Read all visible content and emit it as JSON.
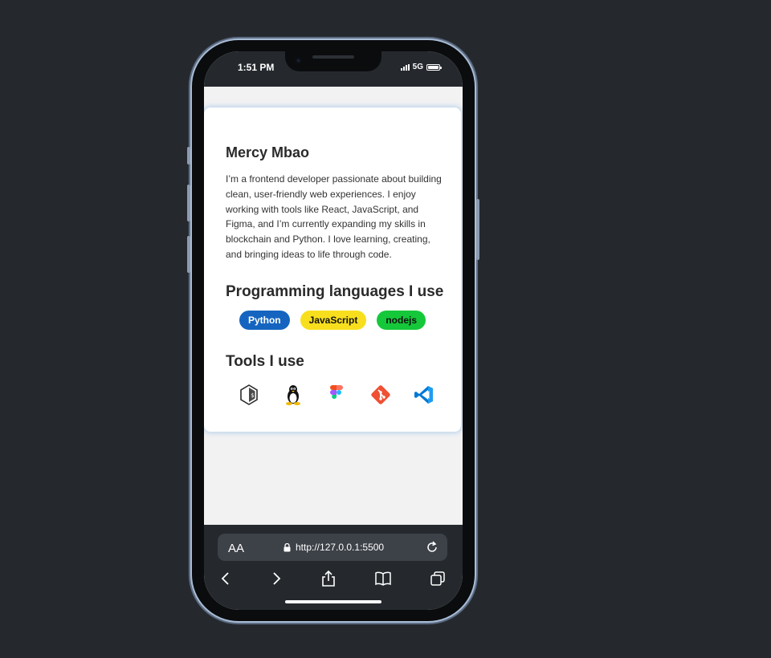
{
  "status": {
    "time": "1:51 PM",
    "network": "5G"
  },
  "profile": {
    "name": "Mercy Mbao",
    "bio": "I’m a frontend developer passionate about building clean, user-friendly web experiences. I enjoy working with tools like React, JavaScript, and Figma, and I’m currently expanding my skills in blockchain and Python. I love learning, creating, and bringing ideas to life through code."
  },
  "languages": {
    "heading": "Programming languages I use",
    "items": [
      {
        "label": "Python",
        "color": "#1565c0"
      },
      {
        "label": "JavaScript",
        "color": "#f7df1e"
      },
      {
        "label": "nodejs",
        "color": "#15c83a"
      }
    ]
  },
  "tools": {
    "heading": "Tools I use",
    "items": [
      "bash-icon",
      "linux-icon",
      "figma-icon",
      "git-icon",
      "vscode-icon"
    ]
  },
  "browser": {
    "text_size": "AA",
    "url": "http://127.0.0.1:5500"
  }
}
